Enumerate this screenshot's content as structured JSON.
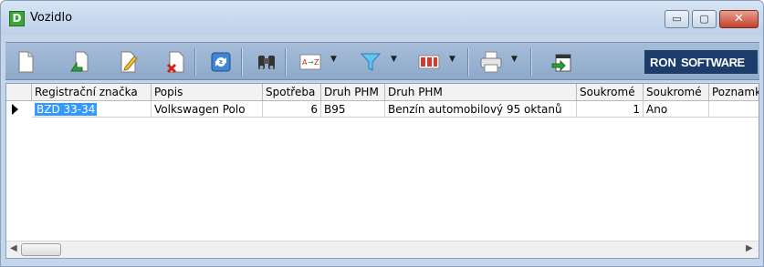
{
  "window": {
    "title": "Vozidlo",
    "app_icon_letter": "D",
    "controls": {
      "minimize": "▭",
      "maximize": "▢",
      "close": "✕"
    }
  },
  "toolbar": {
    "buttons": [
      {
        "icon": "new-document-icon"
      },
      {
        "icon": "open-document-icon"
      },
      {
        "icon": "edit-document-icon"
      },
      {
        "icon": "delete-document-icon"
      },
      {
        "icon": "refresh-icon"
      },
      {
        "icon": "binoculars-icon"
      },
      {
        "icon": "sort-az-icon"
      },
      {
        "icon": "filter-icon"
      },
      {
        "icon": "columns-icon"
      },
      {
        "icon": "printer-icon"
      },
      {
        "icon": "export-icon"
      }
    ],
    "brand": {
      "part1": "RON",
      "part2": "SOFTWARE"
    }
  },
  "grid": {
    "columns": [
      "Registrační značka",
      "Popis",
      "Spotřeba",
      "Druh PHM",
      "Druh PHM",
      "Soukromé",
      "Soukromé",
      "Poznamk"
    ],
    "rows": [
      {
        "registration": "BZD 33-34",
        "description": "Volkswagen Polo",
        "consumption": "6",
        "fuel_code": "B95",
        "fuel_name": "Benzín automobilový 95 oktanů",
        "private_count": "1",
        "private": "Ano",
        "note": ""
      }
    ]
  }
}
